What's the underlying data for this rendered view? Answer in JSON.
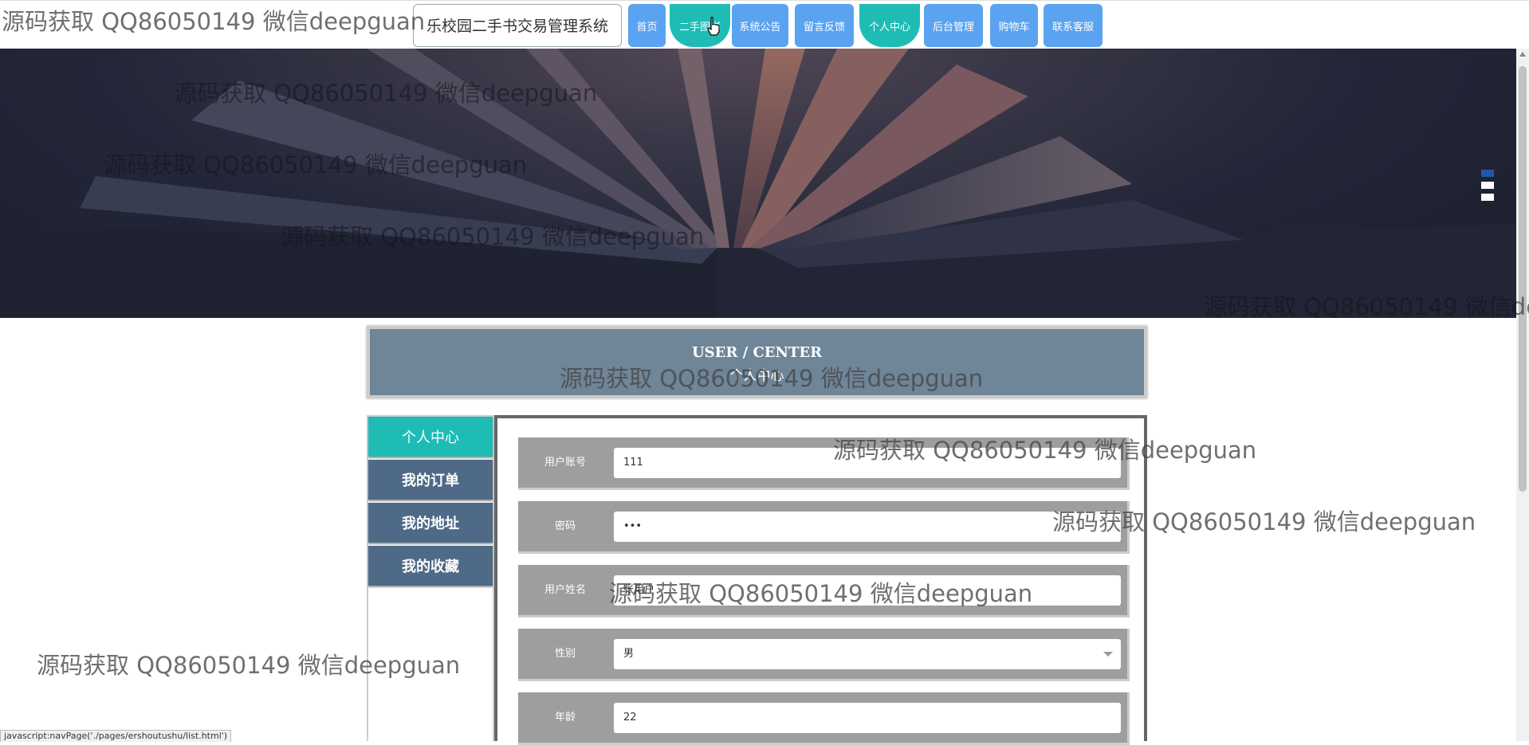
{
  "nav": {
    "title": "乐校园二手书交易管理系统",
    "items": [
      {
        "label": "首页"
      },
      {
        "label": "二手图书"
      },
      {
        "label": "系统公告"
      },
      {
        "label": "留言反馈"
      },
      {
        "label": "个人中心"
      },
      {
        "label": "后台管理"
      },
      {
        "label": "购物车"
      },
      {
        "label": "联系客服"
      }
    ]
  },
  "carousel": {
    "active_index": 0,
    "count": 3
  },
  "center": {
    "title_en": "USER / CENTER",
    "title_cn": "个人中心"
  },
  "menu": {
    "items": [
      {
        "label": "个人中心"
      },
      {
        "label": "我的订单"
      },
      {
        "label": "我的地址"
      },
      {
        "label": "我的收藏"
      }
    ]
  },
  "form": {
    "fields": [
      {
        "label": "用户账号",
        "value": "111"
      },
      {
        "label": "密码",
        "value": "•••"
      },
      {
        "label": "用户姓名",
        "value": "张用户"
      },
      {
        "label": "性别",
        "value": "男"
      },
      {
        "label": "年龄",
        "value": "22"
      }
    ]
  },
  "watermark": "源码获取 QQ86050149 微信deepguan",
  "status_bar": "javascript:navPage('./pages/ershoutushu/list.html')",
  "icons": {
    "cursor": "hand-pointer-icon"
  },
  "colors": {
    "nav_button": "#5aa3f0",
    "nav_active": "#1fbcb6",
    "menu_item": "#4e6a86",
    "menu_active": "#1fbcb6",
    "header_box": "#6f8598"
  }
}
